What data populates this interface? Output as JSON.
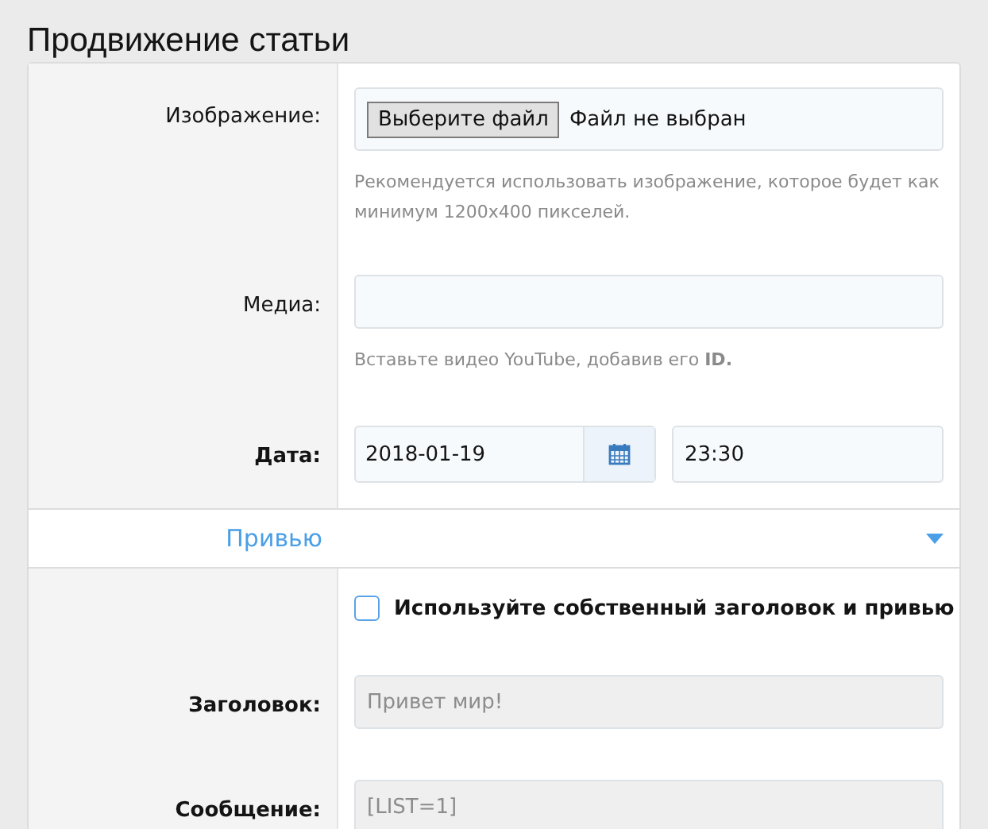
{
  "page_title": "Продвижение статьи",
  "rows": [
    {
      "kind": "file",
      "label": "Изображение:",
      "bold": false,
      "button": "Выберите файл",
      "file_status": "Файл не выбран",
      "hint": "Рекомендуется использовать изображение, которое будет как минимум 1200x400 пикселей."
    },
    {
      "kind": "text",
      "label": "Медиа:",
      "bold": false,
      "disabled": false,
      "hint": "Вставьте видео YouTube, добавив его **ID.**"
    },
    {
      "kind": "datetime",
      "label": "Дата:",
      "bold": true,
      "date": "2018-01-19",
      "time": "23:30"
    },
    {
      "kind": "section",
      "label": "Привью",
      "expanded": true
    },
    {
      "kind": "checkbox",
      "label": "Используйте собственный заголовок и привью",
      "checked": false
    },
    {
      "kind": "text",
      "label": "Заголовок:",
      "bold": true,
      "disabled": true,
      "value": "Привет мир!"
    },
    {
      "kind": "text",
      "label": "Сообщение:",
      "bold": true,
      "disabled": true,
      "value": "[LIST=1]"
    }
  ]
}
